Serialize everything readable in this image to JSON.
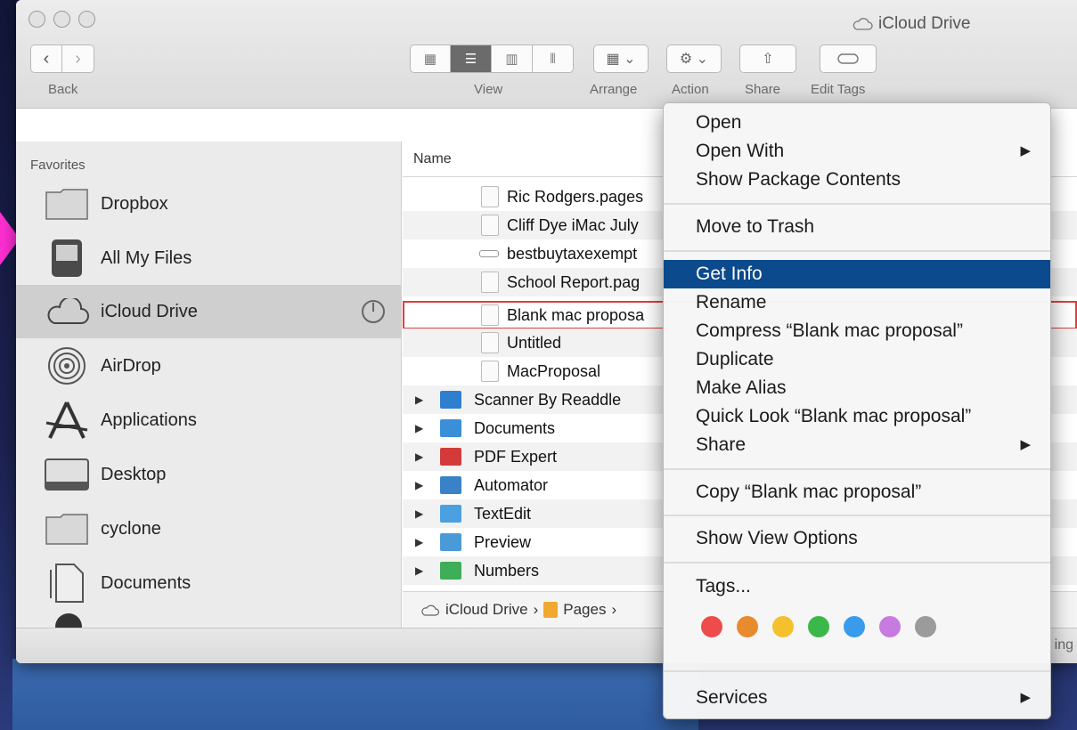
{
  "window": {
    "title": "iCloud Drive"
  },
  "toolbar": {
    "back_label": "Back",
    "view_label": "View",
    "arrange_label": "Arrange",
    "action_label": "Action",
    "share_label": "Share",
    "edit_tags_label": "Edit Tags"
  },
  "sidebar": {
    "heading": "Favorites",
    "items": [
      {
        "label": "Dropbox",
        "icon": "folder-icon"
      },
      {
        "label": "All My Files",
        "icon": "all-my-files-icon"
      },
      {
        "label": "iCloud Drive",
        "icon": "cloud-icon",
        "selected": true
      },
      {
        "label": "AirDrop",
        "icon": "airdrop-icon"
      },
      {
        "label": "Applications",
        "icon": "applications-icon"
      },
      {
        "label": "Desktop",
        "icon": "desktop-icon"
      },
      {
        "label": "cyclone",
        "icon": "folder-icon"
      },
      {
        "label": "Documents",
        "icon": "documents-icon"
      }
    ]
  },
  "filelist": {
    "column_name": "Name",
    "files": [
      {
        "name": "Ric Rodgers.pages"
      },
      {
        "name": "Cliff Dye iMac July"
      },
      {
        "name": "bestbuytaxexempt"
      },
      {
        "name": "School Report.pag"
      },
      {
        "name": "Blank mac proposa"
      },
      {
        "name": "Untitled"
      },
      {
        "name": "MacProposal"
      }
    ],
    "folders": [
      {
        "name": "Scanner By Readdle",
        "color": "#2f7fd0"
      },
      {
        "name": "Documents",
        "color": "#3a8fd8"
      },
      {
        "name": "PDF Expert",
        "color": "#d33b3b"
      },
      {
        "name": "Automator",
        "color": "#3a82c8"
      },
      {
        "name": "TextEdit",
        "color": "#4aa0e0"
      },
      {
        "name": "Preview",
        "color": "#4a9ad8"
      },
      {
        "name": "Numbers",
        "color": "#3fae58"
      }
    ]
  },
  "pathbar": {
    "root": "iCloud Drive",
    "sep": "›",
    "child": "Pages",
    "trail": "›"
  },
  "statusbar": {
    "text": "ing"
  },
  "context_menu": {
    "items": {
      "open": "Open",
      "open_with": "Open With",
      "show_package_contents": "Show Package Contents",
      "move_to_trash": "Move to Trash",
      "get_info": "Get Info",
      "rename": "Rename",
      "compress": "Compress “Blank mac proposal”",
      "duplicate": "Duplicate",
      "make_alias": "Make Alias",
      "quick_look": "Quick Look “Blank mac proposal”",
      "share": "Share",
      "copy": "Copy “Blank mac proposal”",
      "show_view_options": "Show View Options",
      "tags": "Tags...",
      "services": "Services"
    },
    "submenu_arrow": "▶",
    "tag_colors": [
      "#ee4b4b",
      "#e88a2e",
      "#f3c12e",
      "#3cb84a",
      "#3a9bec",
      "#c77be0",
      "#9b9b9b"
    ]
  }
}
